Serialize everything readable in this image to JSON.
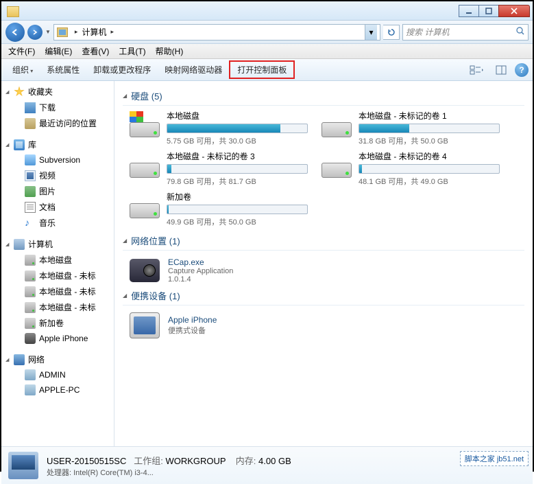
{
  "titlebar": {
    "min": "—",
    "max": "▢",
    "close": "✕"
  },
  "nav": {
    "breadcrumb": {
      "root": "计算机"
    },
    "search_placeholder": "搜索 计算机"
  },
  "menubar": [
    {
      "label": "文件(F)"
    },
    {
      "label": "编辑(E)"
    },
    {
      "label": "查看(V)"
    },
    {
      "label": "工具(T)"
    },
    {
      "label": "帮助(H)"
    }
  ],
  "toolbar": {
    "organize": "组织",
    "props": "系统属性",
    "uninstall": "卸载或更改程序",
    "mapnet": "映射网络驱动器",
    "control": "打开控制面板"
  },
  "sidebar": {
    "favorites": {
      "title": "收藏夹",
      "items": [
        "下载",
        "最近访问的位置"
      ]
    },
    "libraries": {
      "title": "库",
      "items": [
        "Subversion",
        "视频",
        "图片",
        "文档",
        "音乐"
      ]
    },
    "computer": {
      "title": "计算机",
      "items": [
        "本地磁盘",
        "本地磁盘 - 未标",
        "本地磁盘 - 未标",
        "本地磁盘 - 未标",
        "新加卷",
        "Apple iPhone"
      ]
    },
    "network": {
      "title": "网络",
      "items": [
        "ADMIN",
        "APPLE-PC"
      ]
    }
  },
  "categories": {
    "drives_h": "硬盘 (5)",
    "netloc_h": "网络位置 (1)",
    "portable_h": "便携设备 (1)"
  },
  "drives": [
    {
      "name": "本地磁盘",
      "free": "5.75 GB 可用，共 30.0 GB",
      "fill": 81,
      "os": true
    },
    {
      "name": "本地磁盘 - 未标记的卷 1",
      "free": "31.8 GB 可用，共 50.0 GB",
      "fill": 36
    },
    {
      "name": "本地磁盘 - 未标记的卷 3",
      "free": "79.8 GB 可用，共 81.7 GB",
      "fill": 3
    },
    {
      "name": "本地磁盘 - 未标记的卷 4",
      "free": "48.1 GB 可用，共 49.0 GB",
      "fill": 2
    },
    {
      "name": "新加卷",
      "free": "49.9 GB 可用，共 50.0 GB",
      "fill": 1
    }
  ],
  "netloc": {
    "name": "ECap.exe",
    "sub1": "Capture Application",
    "sub2": "1.0.1.4"
  },
  "portable": {
    "name": "Apple iPhone",
    "sub": "便携式设备"
  },
  "details": {
    "name": "USER-20150515SC",
    "wg_label": "工作组:",
    "wg": "WORKGROUP",
    "mem_label": "内存:",
    "mem": "4.00 GB",
    "cpu_label": "处理器:",
    "cpu": "Intel(R) Core(TM) i3-4..."
  },
  "watermark": "脚本之家 jb51.net"
}
